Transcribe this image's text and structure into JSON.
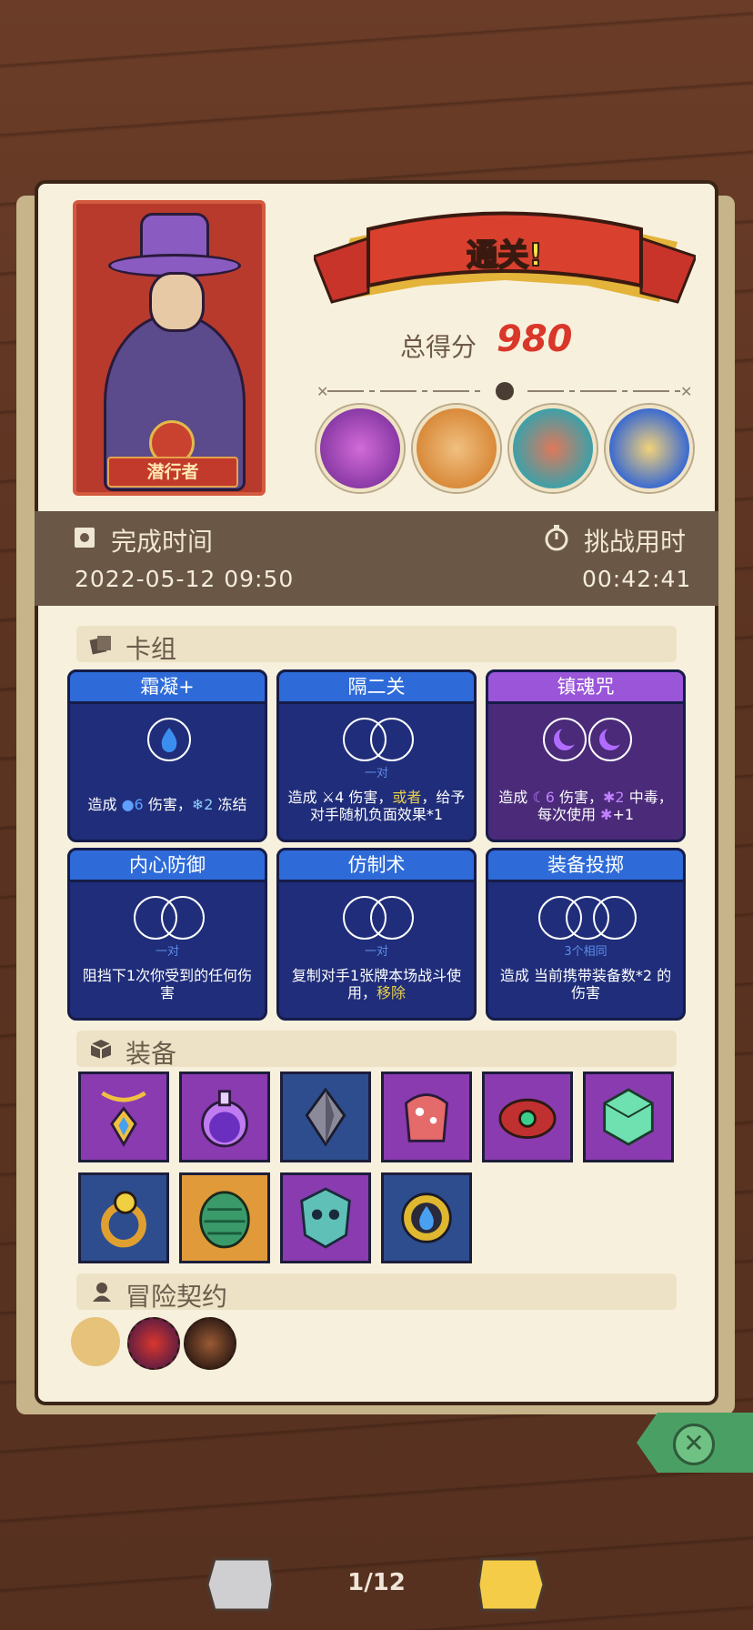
{
  "hero": {
    "name": "潜行者"
  },
  "result": {
    "banner": "通关!",
    "score_label": "总得分",
    "score": "980"
  },
  "bosses": [
    "boss-1",
    "boss-2",
    "boss-3",
    "boss-4"
  ],
  "times": {
    "finish_label": "完成时间",
    "finish_value": "2022-05-12 09:50",
    "duration_label": "挑战用时",
    "duration_value": "00:42:41"
  },
  "deck": {
    "title": "卡组",
    "cards": [
      {
        "name": "霜凝+",
        "sub": "",
        "d1": "造成 ",
        "n1": "6",
        "d2": " 伤害，",
        "n2": "2",
        "d3": " 冻结"
      },
      {
        "name": "隔二关",
        "sub": "一对",
        "d1": "造成 ",
        "n1": "4",
        "d2": " 伤害，",
        "hl": "或者",
        "d3": "，给予对手随机负面效果*1"
      },
      {
        "name": "镇魂咒",
        "sub": "",
        "d1": "造成 ",
        "n1": "6",
        "d2": " 伤害，",
        "n2": "2",
        "d3": " 中毒，每次使用 ",
        "n3": "+1"
      },
      {
        "name": "内心防御",
        "sub": "一对",
        "desc": "阻挡下1次你受到的任何伤害"
      },
      {
        "name": "仿制术",
        "sub": "一对",
        "d1": "复制对手1张牌本场战斗使用，",
        "hl": "移除"
      },
      {
        "name": "装备投掷",
        "sub": "3个相同",
        "desc": "造成 当前携带装备数*2 的伤害"
      }
    ]
  },
  "equipment": {
    "title": "装备"
  },
  "contracts": {
    "title": "冒险契约"
  },
  "nav": {
    "page": "1/12"
  },
  "colors": {
    "accent_red": "#d9372a",
    "card_blue": "#1f2d7a",
    "card_purple": "#4a2a79",
    "close_green": "#4aa064"
  }
}
